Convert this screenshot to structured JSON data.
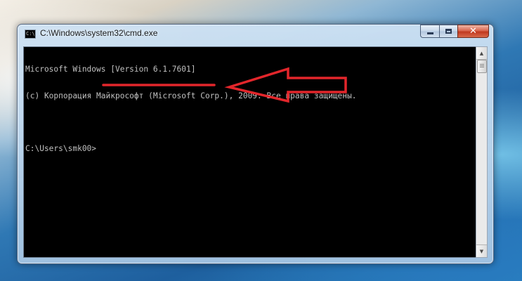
{
  "window": {
    "title": "C:\\Windows\\system32\\cmd.exe",
    "icon_name": "console-icon",
    "icon_label": "C:\\",
    "controls": {
      "minimize_icon": "minimize-icon",
      "maximize_icon": "maximize-icon",
      "close_icon": "close-icon",
      "close_glyph": "✕"
    }
  },
  "console": {
    "lines": [
      "Microsoft Windows [Version 6.1.7601]",
      "(c) Корпорация Майкрософт (Microsoft Corp.), 2009. Все права защищены.",
      "",
      "C:\\Users\\smk00>"
    ],
    "colors": {
      "background": "#000000",
      "text": "#c0c0c0"
    }
  },
  "scrollbar": {
    "up_glyph": "▲",
    "down_glyph": "▼"
  },
  "annotation": {
    "type": "red-arrow-and-underline",
    "color": "#e2262b"
  }
}
